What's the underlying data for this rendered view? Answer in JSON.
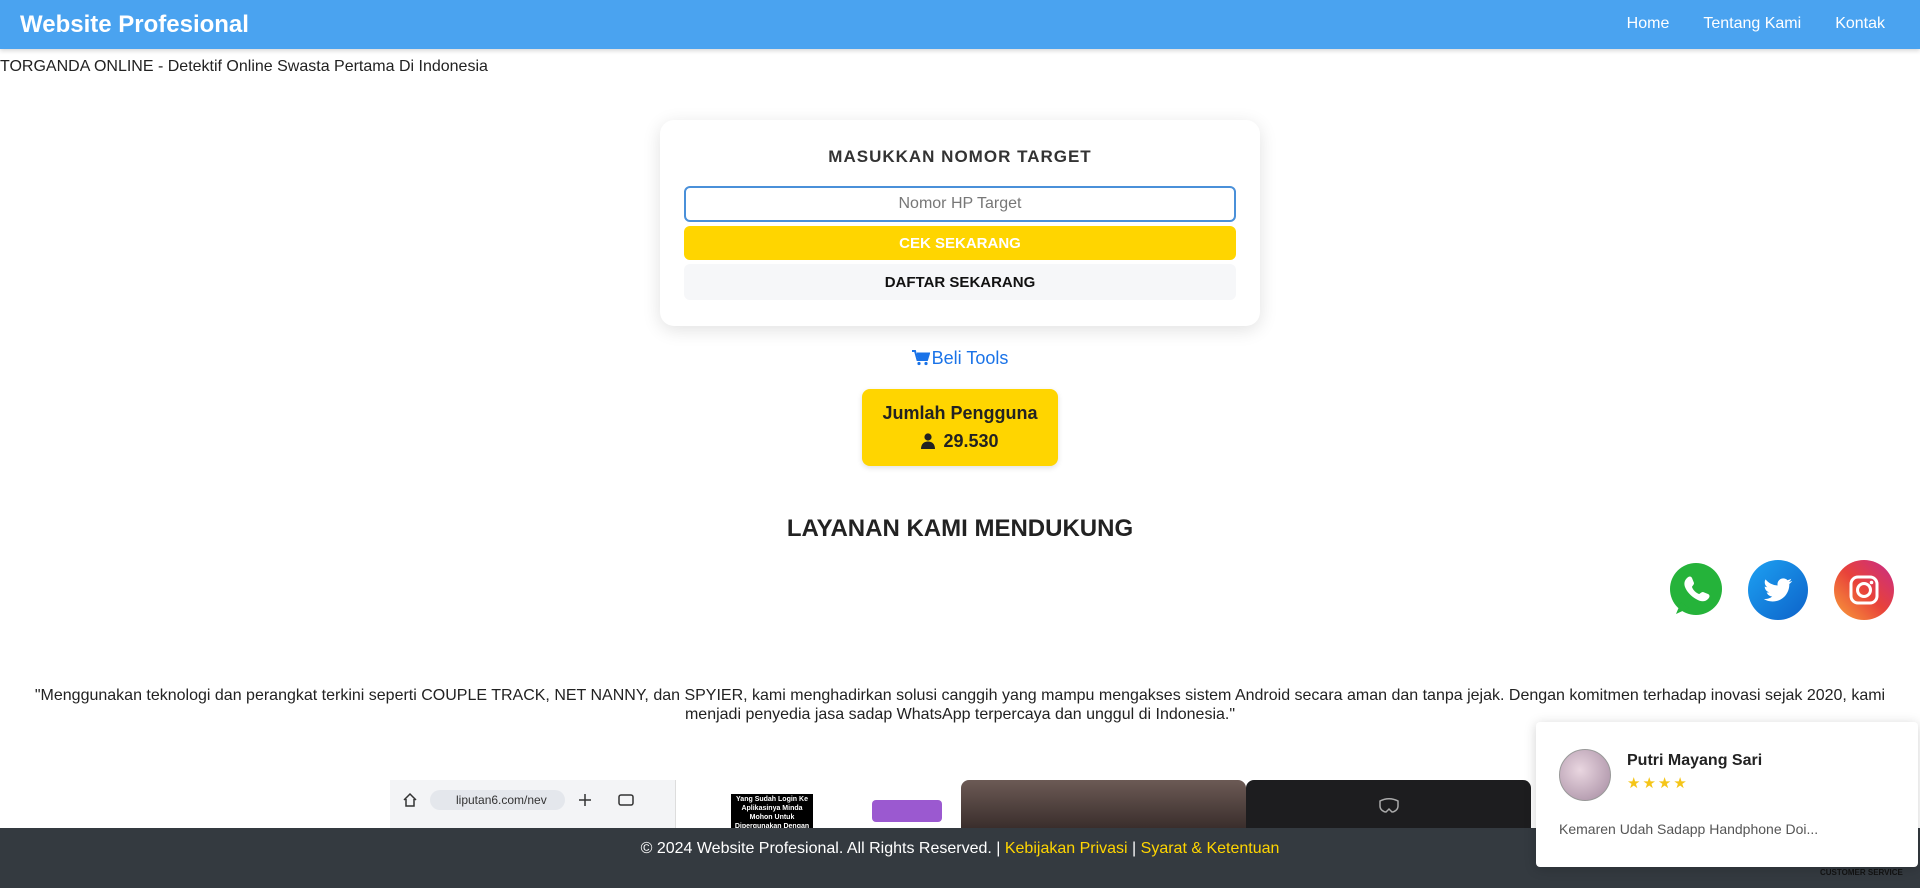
{
  "navbar": {
    "brand": "Website Profesional",
    "links": [
      "Home",
      "Tentang Kami",
      "Kontak"
    ]
  },
  "tagline": "TORGANDA ONLINE - Detektif Online Swasta Pertama Di Indonesia",
  "form": {
    "title": "MASUKKAN NOMOR TARGET",
    "input_placeholder": "Nomor HP Target",
    "input_value": "",
    "check_button": "CEK SEKARANG",
    "register_button": "DAFTAR SEKARANG"
  },
  "beli_tools": "Beli Tools",
  "users": {
    "label": "Jumlah Pengguna",
    "count": "29.530"
  },
  "section_title": "LAYANAN KAMI MENDUKUNG",
  "social_icons": [
    "whatsapp-icon",
    "twitter-icon",
    "instagram-icon"
  ],
  "description": "\"Menggunakan teknologi dan perangkat terkini seperti COUPLE TRACK, NET NANNY, dan SPYIER, kami menghadirkan solusi canggih yang mampu mengakses sistem Android secara aman dan tanpa jejak. Dengan komitmen terhadap inovasi sejak 2020, kami menjadi penyedia jasa sadap WhatsApp terpercaya dan unggul di Indonesia.\"",
  "gallery": {
    "thumb1_url": "liputan6.com/nev",
    "thumb2_caption": "Yang Sudah Login Ke Aplikasinya Minda Mohon Untuk Dipergunakan Dengan Bijak"
  },
  "footer": {
    "copyright": "© 2024 Website Profesional. All Rights Reserved. |",
    "privacy": "Kebijakan Privasi",
    "separator": "|",
    "terms": "Syarat & Ketentuan"
  },
  "review": {
    "name": "Putri Mayang Sari",
    "stars": "★★★★",
    "text": "Kemaren Udah Sadapp Handphone Doi..."
  },
  "customer_service_label": "CUSTOMER SERVICE",
  "colors": {
    "navbar": "#4aa3f0",
    "accent_yellow": "#ffd500",
    "link_blue": "#1a73e8",
    "footer": "#343a40"
  }
}
